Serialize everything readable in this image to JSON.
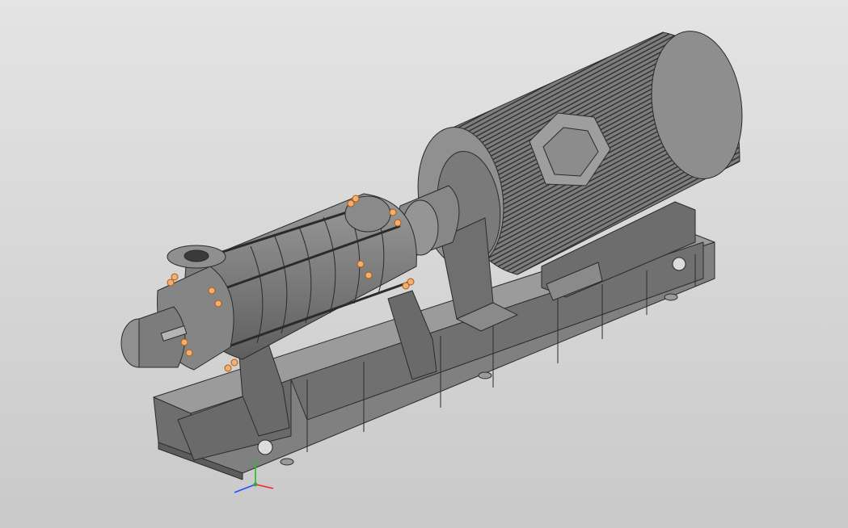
{
  "viewport": {
    "background_top": "#e4e4e4",
    "background_bottom": "#c9c9c9"
  },
  "model": {
    "main_color": "#7a7a7a",
    "dark_color": "#5a5a5a",
    "light_color": "#9a9a9a",
    "edge_color": "#2b2b2b",
    "highlight_color": "#e09a5a",
    "components": [
      "pump-assembly",
      "electric-motor",
      "coupling",
      "base-frame"
    ]
  },
  "axes_triad": {
    "x_color": "#ff2020",
    "y_color": "#20c020",
    "z_color": "#2050ff"
  }
}
